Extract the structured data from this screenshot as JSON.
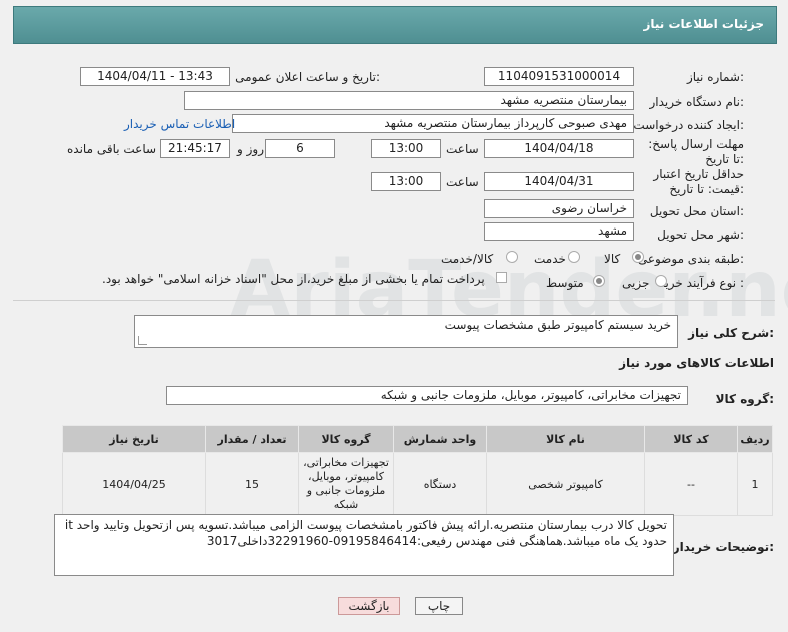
{
  "header": {
    "title": "جزئیات اطلاعات نیاز"
  },
  "fields": {
    "need_number_label": "شماره نیاز:",
    "need_number": "1104091531000014",
    "announce_label": "تاریخ و ساعت اعلان عمومی:",
    "announce_value": "1404/04/11 - 13:43",
    "buyer_org_label": "نام دستگاه خریدار:",
    "buyer_org": "بیمارستان منتصریه مشهد",
    "requester_label": "ایجاد کننده درخواست:",
    "requester": "مهدی صبوحی کارپرداز بیمارستان منتصریه مشهد",
    "contact_link": "اطلاعات تماس خریدار",
    "deadline_label": "مهلت ارسال پاسخ: تا تاریخ:",
    "deadline_date": "1404/04/18",
    "time_label": "ساعت",
    "deadline_time": "13:00",
    "days": "6",
    "days_label": "روز و",
    "remaining": "21:45:17",
    "remaining_label": "ساعت باقی مانده",
    "price_label": "حداقل تاریخ اعتبار قیمت: تا تاریخ:",
    "price_date": "1404/04/31",
    "price_time_label": "ساعت",
    "price_time": "13:00",
    "province_label": "استان محل تحویل:",
    "province": "خراسان رضوی",
    "city_label": "شهر محل تحویل:",
    "city": "مشهد",
    "category_label": "طبقه بندی موضوعی:",
    "category_options": [
      "کالا",
      "خدمت",
      "کالا/خدمت"
    ],
    "purchase_label": "نوع فرآیند خرید :",
    "purchase_options": [
      "جزیی",
      "متوسط"
    ],
    "payment_note": "پرداخت تمام یا بخشی از مبلغ خرید،از محل \"اسناد خزانه اسلامی\" خواهد بود."
  },
  "description": {
    "label": "شرح کلی نیاز:",
    "value": "خرید سیستم کامپیوتر طبق مشخصات پیوست"
  },
  "goods_section": {
    "title": "اطلاعات کالاهای مورد نیاز"
  },
  "goods_group": {
    "label": "گروه کالا:",
    "value": "تجهیزات مخابراتی، کامپیوتر، موبایل، ملزومات جانبی و شبکه"
  },
  "table": {
    "headers": [
      "ردیف",
      "کد کالا",
      "نام کالا",
      "واحد شمارش",
      "گروه کالا",
      "تعداد / مقدار",
      "تاریخ نیاز"
    ],
    "rows": [
      [
        "1",
        "--",
        "کامپیوتر شخصی",
        "دستگاه",
        "تجهیزات مخابراتی، کامپیوتر، موبایل، ملزومات جانبی و شبکه",
        "15",
        "1404/04/25"
      ]
    ]
  },
  "buyer_notes": {
    "label": "توضیحات خریدار:",
    "value": "تحویل کالا درب بیمارستان منتصریه.ارائه پیش فاکتور بامشخصات پیوست الزامی میباشد.تسویه پس ازتحویل وتایید واحد it حدود یک ماه میباشد.هماهنگی فنی مهندس رفیعی:09195846414-32291960داخلی3017"
  },
  "buttons": {
    "print": "چاپ",
    "back": "بازگشت"
  },
  "watermark": "AriaTender.neT"
}
